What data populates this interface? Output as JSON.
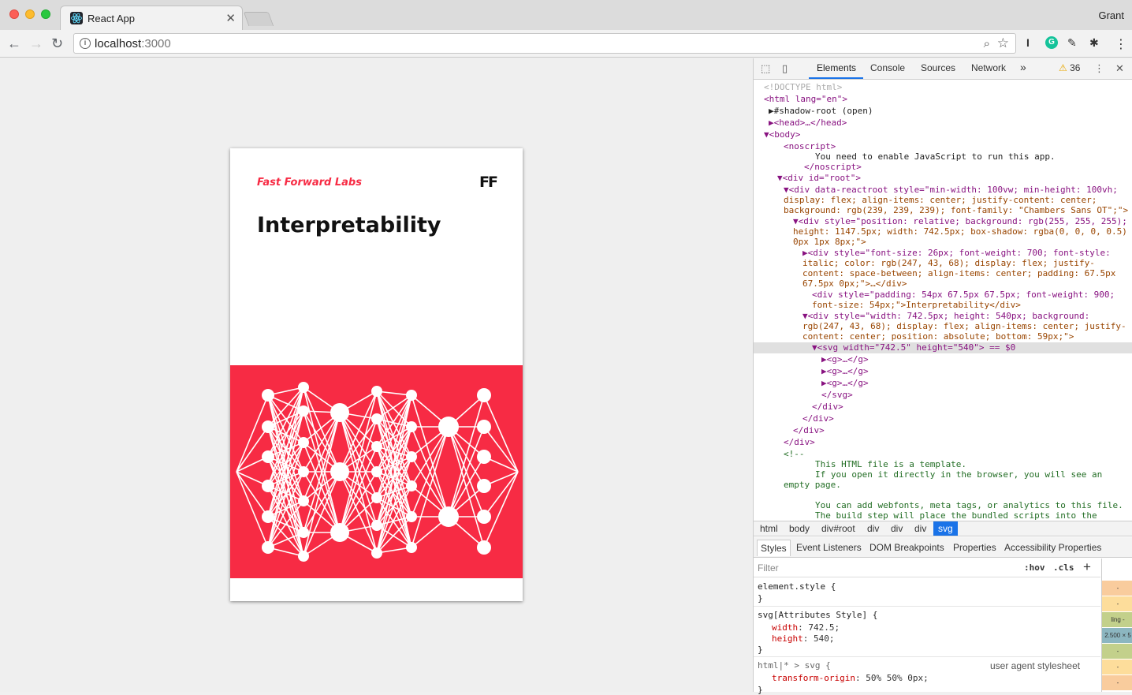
{
  "browser": {
    "tab_title": "React App",
    "profile_name": "Grant",
    "url_host": "localhost",
    "url_port": ":3000"
  },
  "page": {
    "brand": "Fast Forward Labs",
    "logo": "FF",
    "title": "Interpretability",
    "art_color": "#f72b44"
  },
  "devtools": {
    "tabs": [
      "Elements",
      "Console",
      "Sources",
      "Network"
    ],
    "more": "»",
    "warning_count": "36",
    "dom_lines": [
      "<!DOCTYPE html>",
      "<html lang=\"en\">",
      "▶#shadow-root (open)",
      "▶<head>…</head>",
      "▼<body>",
      "<noscript>",
      "You need to enable JavaScript to run this app.",
      "</noscript>",
      "▼<div id=\"root\">",
      "▼<div data-reactroot style=\"min-width: 100vw; min-height: 100vh;",
      "display: flex; align-items: center; justify-content: center;",
      "background: rgb(239, 239, 239); font-family: \"Chambers Sans OT\";\">",
      "▼<div style=\"position: relative; background: rgb(255, 255, 255);",
      "height: 1147.5px; width: 742.5px; box-shadow: rgba(0, 0, 0, 0.5)",
      "0px 1px 8px;\">",
      "▶<div style=\"font-size: 26px; font-weight: 700; font-style:",
      "italic; color: rgb(247, 43, 68); display: flex; justify-",
      "content: space-between; align-items: center; padding: 67.5px",
      "67.5px 0px;\">…</div>",
      "<div style=\"padding: 54px 67.5px 67.5px; font-weight: 900;",
      "font-size: 54px;\">Interpretability</div>",
      "▼<div style=\"width: 742.5px; height: 540px; background:",
      "rgb(247, 43, 68); display: flex; align-items: center; justify-",
      "content: center; position: absolute; bottom: 59px;\">",
      "▼<svg width=\"742.5\" height=\"540\"> == $0",
      "▶<g>…</g>",
      "▶<g>…</g>",
      "▶<g>…</g>",
      "</svg>",
      "</div>",
      "</div>",
      "</div>",
      "</div>",
      "<!--",
      "This HTML file is a template.",
      "If you open it directly in the browser, you will see an",
      "empty page.",
      "You can add webfonts, meta tags, or analytics to this file.",
      "The build step will place the bundled scripts into the"
    ],
    "breadcrumbs": [
      "html",
      "body",
      "div#root",
      "div",
      "div",
      "div",
      "svg"
    ],
    "subtabs": [
      "Styles",
      "Event Listeners",
      "DOM Breakpoints",
      "Properties",
      "Accessibility Properties"
    ],
    "filter_placeholder": "Filter",
    "hov": ":hov",
    "cls": ".cls",
    "styles": {
      "element_style": "element.style {",
      "close": "}",
      "svg_attr_selector": "svg[Attributes Style] {",
      "width_prop": "width",
      "width_val": "742.5;",
      "height_prop": "height",
      "height_val": "540;",
      "ua_selector": "html|* > svg {",
      "ua_label": "user agent stylesheet",
      "transform_prop": "transform-origin",
      "transform_val": "50% 50% 0px;"
    },
    "boxmodel": [
      "-",
      "-",
      "ling -",
      "2.500 × 5",
      "-",
      "-",
      "-"
    ]
  }
}
